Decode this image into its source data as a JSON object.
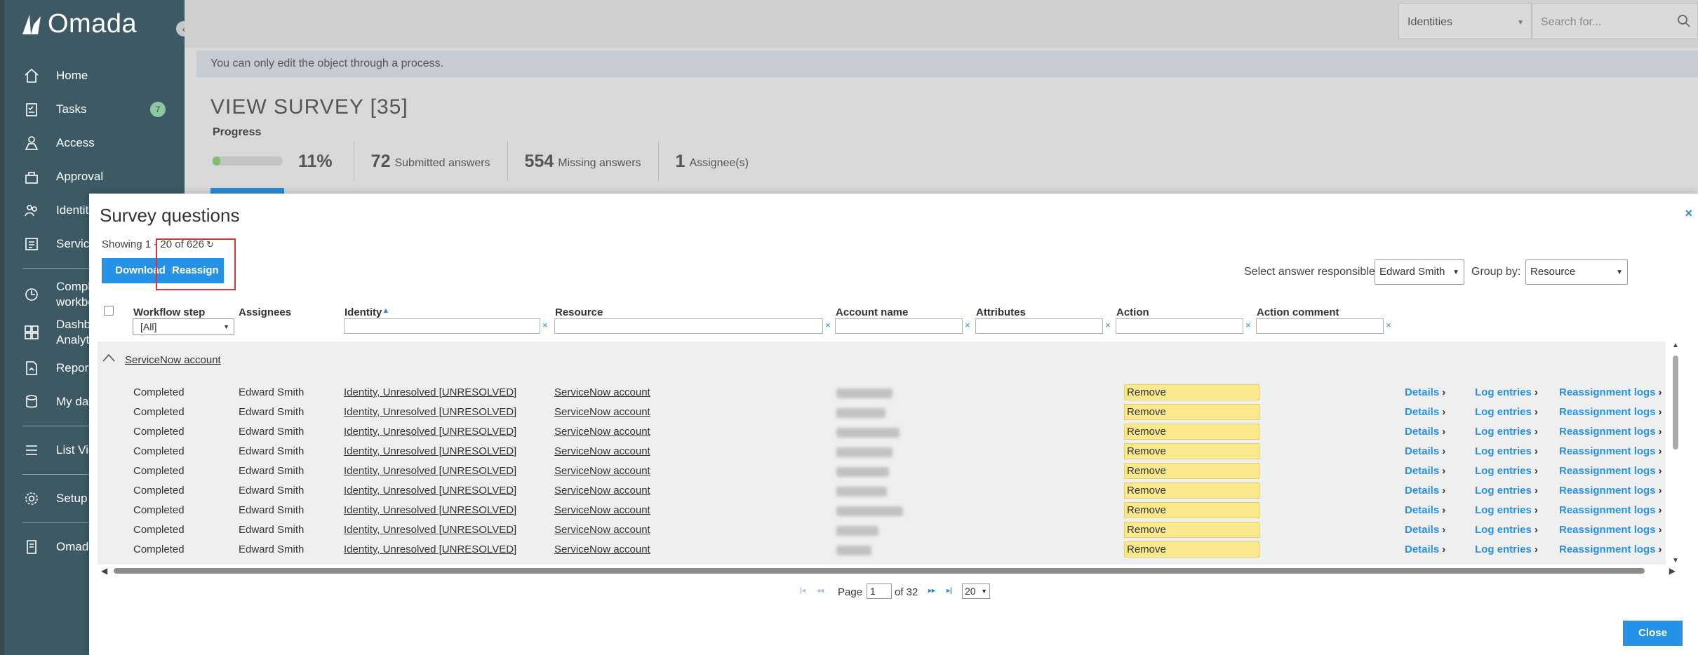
{
  "app": {
    "logo_text": "Omada"
  },
  "sidebar": {
    "items": [
      {
        "label": "Home",
        "icon": "home-icon"
      },
      {
        "label": "Tasks",
        "icon": "tasks-icon",
        "badge": "7"
      },
      {
        "label": "Access",
        "icon": "access-icon"
      },
      {
        "label": "Approval",
        "icon": "approval-icon"
      },
      {
        "label": "Identiti",
        "icon": "identities-icon"
      },
      {
        "label": "Service",
        "icon": "services-icon"
      },
      {
        "label": "Compli workbe",
        "icon": "compliance-icon"
      },
      {
        "label": "Dashbo Analyt",
        "icon": "dashboard-icon"
      },
      {
        "label": "Report",
        "icon": "reports-icon"
      },
      {
        "label": "My dat",
        "icon": "my-data-icon"
      },
      {
        "label": "List Vie",
        "icon": "list-view-icon"
      },
      {
        "label": "Setup",
        "icon": "setup-icon"
      },
      {
        "label": "Omada",
        "icon": "omada-docs-icon"
      }
    ]
  },
  "topbar": {
    "scope_select": "Identities",
    "search_placeholder": "Search for..."
  },
  "page": {
    "info_message": "You can only edit the object through a process.",
    "title": "VIEW SURVEY [35]",
    "progress_label": "Progress",
    "progress_fraction": 0.11,
    "progress_percent": "11%",
    "stats": [
      {
        "num": "72",
        "label": "Submitted answers"
      },
      {
        "num": "554",
        "label": "Missing answers"
      },
      {
        "num": "1",
        "label": "Assignee(s)"
      }
    ]
  },
  "modal": {
    "title": "Survey questions",
    "showing": "Showing 1 - 20 of 626",
    "download_label": "Download",
    "reassign_label": "Reassign",
    "select_answer_label": "Select answer responsible",
    "answer_responsible": "Edward Smith",
    "group_by_label": "Group by:",
    "group_by": "Resource",
    "columns": [
      "Workflow step",
      "Assignees",
      "Identity",
      "Resource",
      "Account name",
      "Attributes",
      "Action",
      "Action comment"
    ],
    "workflow_filter": "[All]",
    "group_label": "ServiceNow account",
    "row_link_labels": {
      "details": "Details",
      "log": "Log entries",
      "reassign": "Reassignment logs"
    },
    "rows": [
      {
        "step": "Completed",
        "assignee": "Edward Smith",
        "identity": "Identity, Unresolved [UNRESOLVED]",
        "resource": "ServiceNow account",
        "action": "Remove"
      },
      {
        "step": "Completed",
        "assignee": "Edward Smith",
        "identity": "Identity, Unresolved [UNRESOLVED]",
        "resource": "ServiceNow account",
        "action": "Remove"
      },
      {
        "step": "Completed",
        "assignee": "Edward Smith",
        "identity": "Identity, Unresolved [UNRESOLVED]",
        "resource": "ServiceNow account",
        "action": "Remove"
      },
      {
        "step": "Completed",
        "assignee": "Edward Smith",
        "identity": "Identity, Unresolved [UNRESOLVED]",
        "resource": "ServiceNow account",
        "action": "Remove"
      },
      {
        "step": "Completed",
        "assignee": "Edward Smith",
        "identity": "Identity, Unresolved [UNRESOLVED]",
        "resource": "ServiceNow account",
        "action": "Remove"
      },
      {
        "step": "Completed",
        "assignee": "Edward Smith",
        "identity": "Identity, Unresolved [UNRESOLVED]",
        "resource": "ServiceNow account",
        "action": "Remove"
      },
      {
        "step": "Completed",
        "assignee": "Edward Smith",
        "identity": "Identity, Unresolved [UNRESOLVED]",
        "resource": "ServiceNow account",
        "action": "Remove"
      },
      {
        "step": "Completed",
        "assignee": "Edward Smith",
        "identity": "Identity, Unresolved [UNRESOLVED]",
        "resource": "ServiceNow account",
        "action": "Remove"
      },
      {
        "step": "Completed",
        "assignee": "Edward Smith",
        "identity": "Identity, Unresolved [UNRESOLVED]",
        "resource": "ServiceNow account",
        "action": "Remove"
      }
    ],
    "pager": {
      "page_label": "Page",
      "page": "1",
      "of_label": "of 32",
      "page_size": "20"
    },
    "close_label": "Close"
  }
}
